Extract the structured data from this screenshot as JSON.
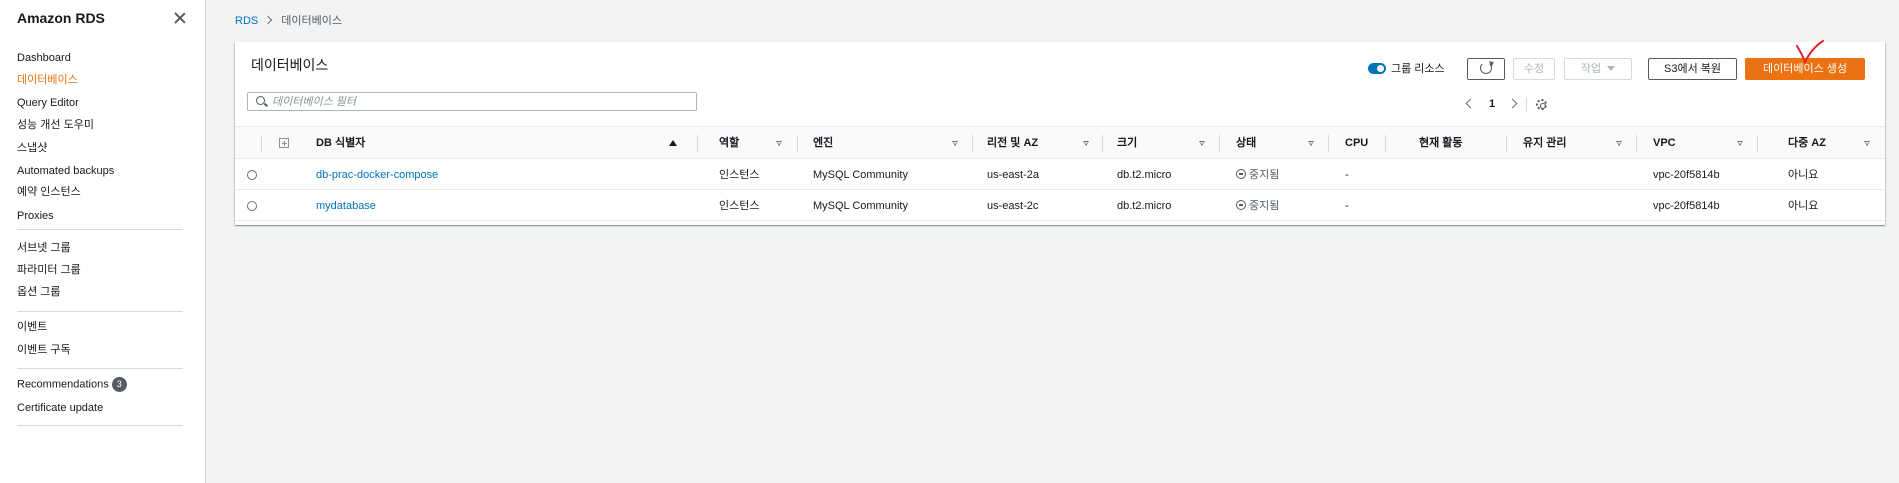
{
  "sidebar": {
    "title": "Amazon RDS",
    "items": [
      {
        "label": "Dashboard"
      },
      {
        "label": "데이터베이스"
      },
      {
        "label": "Query Editor"
      },
      {
        "label": "성능 개선 도우미"
      },
      {
        "label": "스냅샷"
      },
      {
        "label": "Automated backups"
      },
      {
        "label": "예약 인스턴스"
      },
      {
        "label": "Proxies"
      },
      {
        "label": "서브넷 그룹"
      },
      {
        "label": "파라미터 그룹"
      },
      {
        "label": "옵션 그룹"
      },
      {
        "label": "이벤트"
      },
      {
        "label": "이벤트 구독"
      },
      {
        "label": "Recommendations",
        "badge": "3"
      },
      {
        "label": "Certificate update"
      }
    ],
    "active_item": "데이터베이스"
  },
  "breadcrumb": {
    "root": "RDS",
    "current": "데이터베이스"
  },
  "panel": {
    "title": "데이터베이스",
    "group_toggle_label": "그룹 리소스",
    "group_toggle_on": true,
    "buttons": {
      "modify": "수정",
      "actions": "작업",
      "restore_s3": "S3에서 복원",
      "create": "데이터베이스 생성"
    },
    "search": {
      "placeholder": "데이터베이스 필터",
      "value": ""
    },
    "pagination": {
      "page": "1"
    }
  },
  "table": {
    "columns": [
      "DB 식별자",
      "역할",
      "엔진",
      "리전 및 AZ",
      "크기",
      "상태",
      "CPU",
      "현재 활동",
      "유지 관리",
      "VPC",
      "다중 AZ"
    ],
    "rows": [
      [
        "db-prac-docker-compose",
        "인스턴스",
        "MySQL Community",
        "us-east-2a",
        "db.t2.micro",
        "중지됨",
        "-",
        "",
        "",
        "vpc-20f5814b",
        "아니요"
      ],
      [
        "mydatabase",
        "인스턴스",
        "MySQL Community",
        "us-east-2c",
        "db.t2.micro",
        "중지됨",
        "-",
        "",
        "",
        "vpc-20f5814b",
        "아니요"
      ]
    ]
  },
  "colors": {
    "accent": "#ec7211",
    "link": "#0073bb",
    "annotation": "#e0262b"
  }
}
